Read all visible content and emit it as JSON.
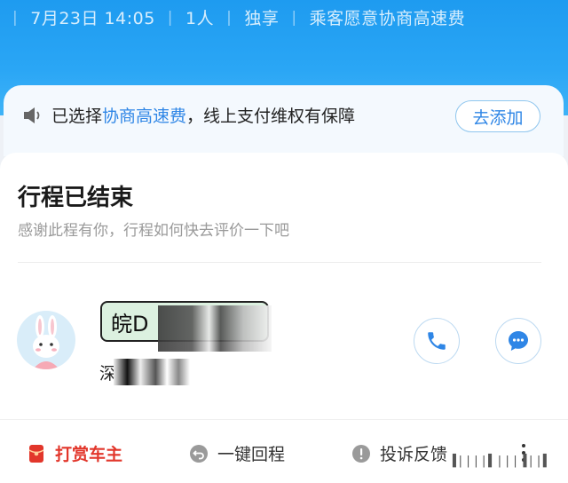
{
  "header": {
    "datetime": "7月23日 14:05",
    "passengers": "1人",
    "ride_type": "独享",
    "toll_note": "乘客愿意协商高速费"
  },
  "notice": {
    "prefix": "已选择",
    "highlight": "协商高速费",
    "suffix": "，线上支付维权有保障",
    "add_button": "去添加",
    "accent_color": "#2f86e6"
  },
  "trip": {
    "title": "行程已结束",
    "subtitle": "感谢此程有你，行程如何快去评价一下吧"
  },
  "driver": {
    "plate_prefix": "皖D",
    "name_prefix": "深"
  },
  "bottom_actions": {
    "tip": "打赏车主",
    "one_click_return": "一键回程",
    "complaint": "投诉反馈"
  },
  "icons": [
    "speaker-icon",
    "rabbit-avatar-icon",
    "phone-icon",
    "chat-bubble-icon",
    "red-envelope-icon",
    "return-arrow-icon",
    "alert-icon",
    "more-vertical-icon"
  ]
}
